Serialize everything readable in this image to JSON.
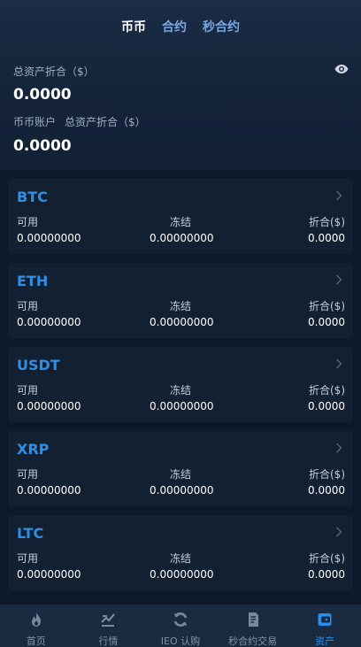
{
  "tabs": [
    {
      "label": "币币",
      "active": true
    },
    {
      "label": "合约",
      "active": false
    },
    {
      "label": "秒合约",
      "active": false
    }
  ],
  "summary": {
    "total_label": "总资产折合（$）",
    "total_value": "0.0000",
    "account_label": "币币账户",
    "account_total_label": "总资产折合（$）",
    "account_value": "0.0000",
    "eye_icon": "eye-icon"
  },
  "columns": {
    "available": "可用",
    "frozen": "冻结",
    "converted": "折合($)"
  },
  "assets": [
    {
      "coin": "BTC",
      "available": "0.00000000",
      "frozen": "0.00000000",
      "converted": "0.0000"
    },
    {
      "coin": "ETH",
      "available": "0.00000000",
      "frozen": "0.00000000",
      "converted": "0.0000"
    },
    {
      "coin": "USDT",
      "available": "0.00000000",
      "frozen": "0.00000000",
      "converted": "0.0000"
    },
    {
      "coin": "XRP",
      "available": "0.00000000",
      "frozen": "0.00000000",
      "converted": "0.0000"
    },
    {
      "coin": "LTC",
      "available": "0.00000000",
      "frozen": "0.00000000",
      "converted": "0.0000"
    }
  ],
  "nav": [
    {
      "label": "首页",
      "icon": "flame-icon",
      "active": false
    },
    {
      "label": "行情",
      "icon": "market-icon",
      "active": false
    },
    {
      "label": "IEO 认购",
      "icon": "refresh-icon",
      "active": false
    },
    {
      "label": "秒合约交易",
      "icon": "document-icon",
      "active": false
    },
    {
      "label": "资产",
      "icon": "wallet-icon",
      "active": true
    }
  ],
  "colors": {
    "background": "#0d1828",
    "card": "#132031",
    "accent": "#2a8fe8",
    "coin_text": "#2f8fe6"
  }
}
